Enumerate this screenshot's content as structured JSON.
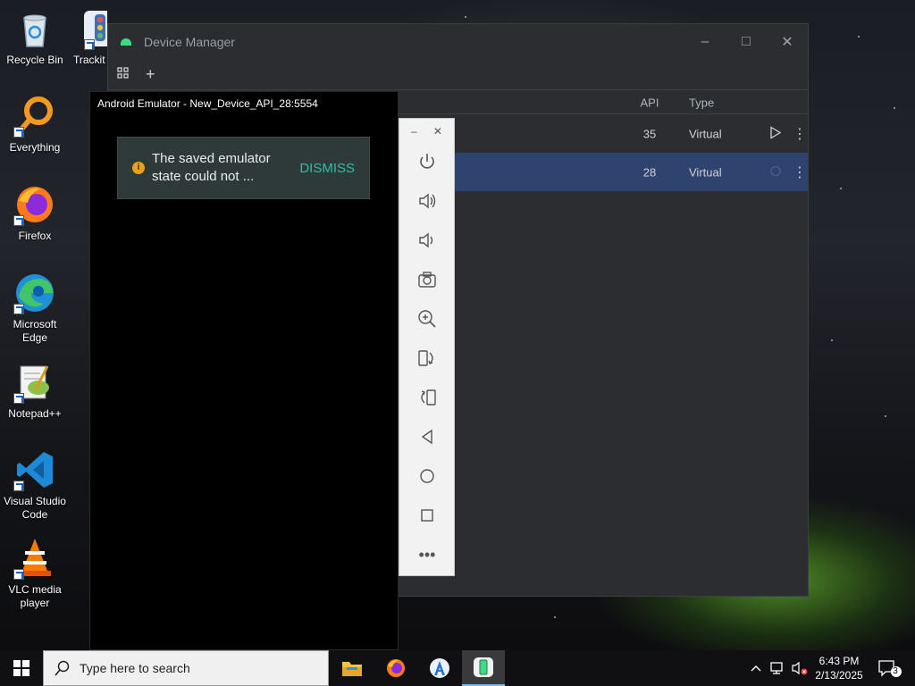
{
  "desktop": {
    "icons": [
      {
        "label": "Recycle Bin"
      },
      {
        "label": "Everything"
      },
      {
        "label": "Firefox"
      },
      {
        "label": "Microsoft Edge"
      },
      {
        "label": "Notepad++"
      },
      {
        "label": "Visual Studio Code"
      },
      {
        "label": "VLC media player"
      },
      {
        "label": "Trackit"
      }
    ]
  },
  "device_manager": {
    "title": "Device Manager",
    "toolbar": {
      "add_label": "+"
    },
    "columns": {
      "api": "API",
      "type": "Type"
    },
    "rows": [
      {
        "api": "35",
        "type": "Virtual"
      },
      {
        "api": "28",
        "type": "Virtual"
      }
    ]
  },
  "emulator": {
    "title": "Android Emulator - New_Device_API_28:5554",
    "toast": {
      "message": "The saved emulator state could not ...",
      "action": "DISMISS"
    },
    "toolbar": [
      "power-icon",
      "volume-up-icon",
      "volume-down-icon",
      "camera-icon",
      "zoom-icon",
      "rotate-left-icon",
      "rotate-right-icon",
      "back-icon",
      "home-icon",
      "overview-icon",
      "more-icon"
    ]
  },
  "taskbar": {
    "search_placeholder": "Type here to search",
    "time": "6:43 PM",
    "date": "2/13/2025",
    "notification_count": "3"
  },
  "colors": {
    "accent_teal": "#2bbfa4",
    "selected_row": "#2e436e",
    "android_green": "#3ddc84"
  }
}
